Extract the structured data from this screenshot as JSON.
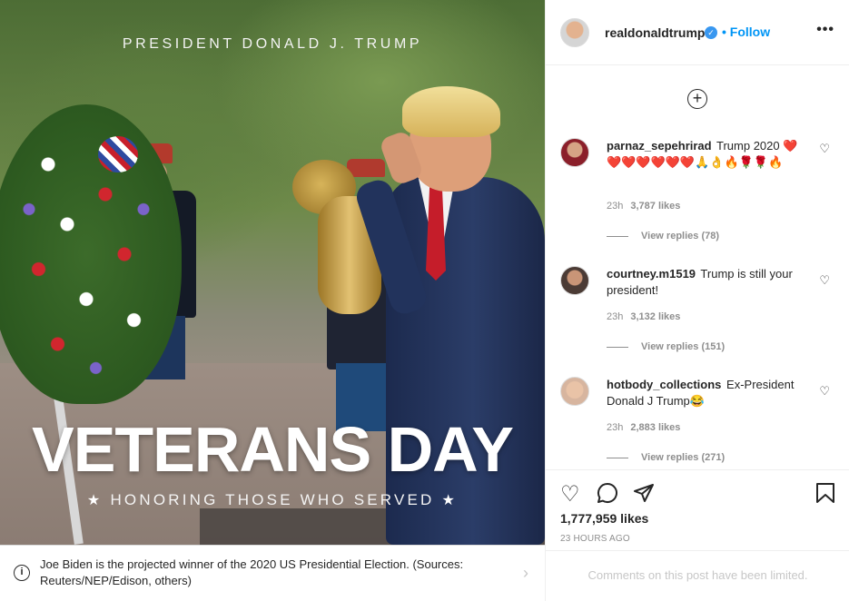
{
  "photo": {
    "top_title": "PRESIDENT DONALD J. TRUMP",
    "headline": "VETERANS DAY",
    "subtitle": "HONORING THOSE WHO SERVED"
  },
  "notice": {
    "text": "Joe Biden is the projected winner of the 2020 US Presidential Election. (Sources: Reuters/NEP/Edison, others)"
  },
  "header": {
    "username": "realdonaldtrump",
    "follow_label": "Follow",
    "separator": "•"
  },
  "comments": [
    {
      "username": "parnaz_sepehrirad",
      "text": "Trump 2020 ❤️❤️❤️❤️❤️❤️❤️🙏👌🔥🌹🌹🔥",
      "time": "23h",
      "likes": "3,787 likes",
      "replies": "View replies (78)"
    },
    {
      "username": "courtney.m1519",
      "text": "Trump is still your president!",
      "time": "23h",
      "likes": "3,132 likes",
      "replies": "View replies (151)"
    },
    {
      "username": "hotbody_collections",
      "text": "Ex-President Donald J Trump😂",
      "time": "23h",
      "likes": "2,883 likes",
      "replies": "View replies (271)"
    }
  ],
  "post": {
    "likes": "1,777,959 likes",
    "time_ago": "23 HOURS AGO",
    "comments_limited": "Comments on this post have been limited."
  },
  "colors": {
    "accent": "#0095f6",
    "verified": "#3897f0",
    "muted": "#8e8e8e",
    "border": "#dbdbdb"
  }
}
